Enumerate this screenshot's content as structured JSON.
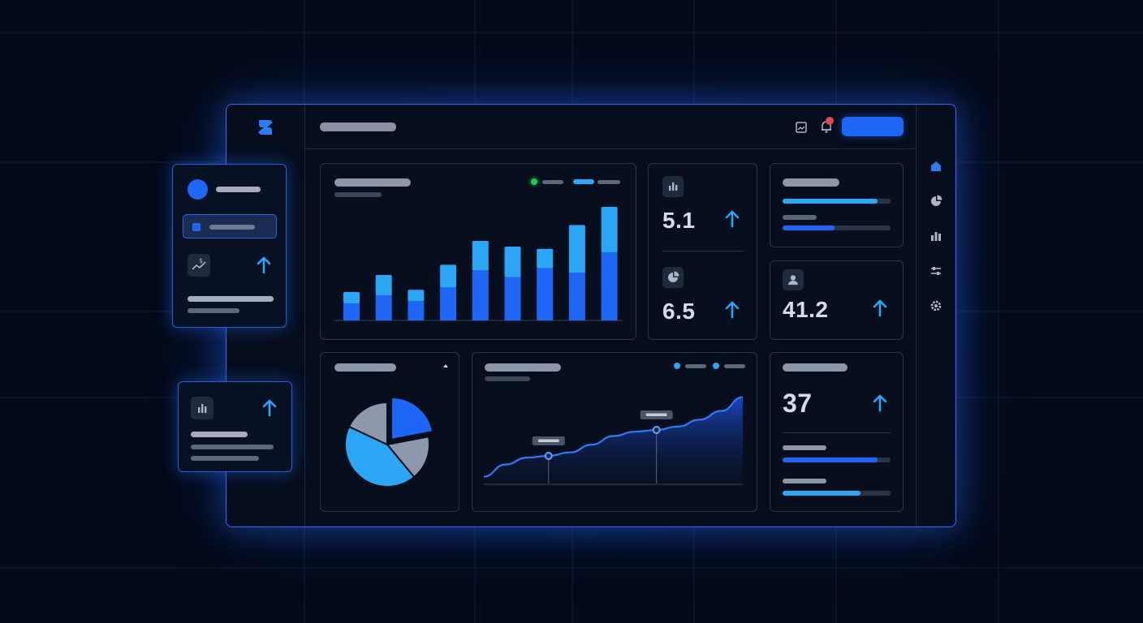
{
  "metrics": {
    "m1": {
      "value": "5.1",
      "icon": "bar-chart-icon",
      "trend": "up"
    },
    "m2": {
      "value": "6.5",
      "icon": "pie-chart-icon",
      "trend": "up"
    },
    "m3": {
      "value": "41.2",
      "icon": "user-icon",
      "trend": "up"
    },
    "m4": {
      "value": "37",
      "trend": "up"
    }
  },
  "progress": {
    "top_card": [
      0.88,
      0.48
    ],
    "bottom_card": [
      0.88,
      0.72
    ]
  },
  "colors": {
    "accent": "#1e66f5",
    "accent_light": "#2aa6f5",
    "slate": "#8d98ad",
    "notification": "#e5484d",
    "legend_green": "#22c55e"
  },
  "icons": {
    "logo": "brand-logo-icon",
    "top": [
      "image-icon",
      "bell-icon"
    ],
    "right_nav": [
      "home-icon",
      "pie-chart-icon",
      "bar-chart-icon",
      "sliders-icon",
      "gear-icon"
    ],
    "floating": [
      "dollar-trend-icon",
      "bar-chart-icon",
      "arrow-up-icon"
    ]
  },
  "chart_data": [
    {
      "type": "bar",
      "stacked": true,
      "categories": [
        "",
        "",
        "",
        "",
        "",
        "",
        "",
        "",
        ""
      ],
      "series": [
        {
          "values": [
            15,
            22,
            17,
            29,
            44,
            38,
            46,
            42,
            60
          ]
        },
        {
          "values": [
            10,
            18,
            10,
            20,
            26,
            27,
            17,
            42,
            40
          ]
        }
      ],
      "ylim": [
        0,
        100
      ],
      "grid": false
    },
    {
      "type": "pie",
      "values": [
        22,
        17,
        43,
        18
      ],
      "colors": [
        "#1e66f5",
        "#8d98ad",
        "#2aa6f5",
        "#8d98ad"
      ],
      "exploded_index": 0
    },
    {
      "type": "area",
      "x": [
        0,
        1,
        2,
        3,
        4,
        5,
        6,
        7,
        8,
        9,
        10,
        11,
        12
      ],
      "values": [
        8,
        22,
        30,
        32,
        36,
        45,
        55,
        60,
        62,
        66,
        74,
        84,
        100
      ],
      "ylim": [
        0,
        110
      ],
      "highlighted_points": [
        3,
        8
      ]
    }
  ]
}
